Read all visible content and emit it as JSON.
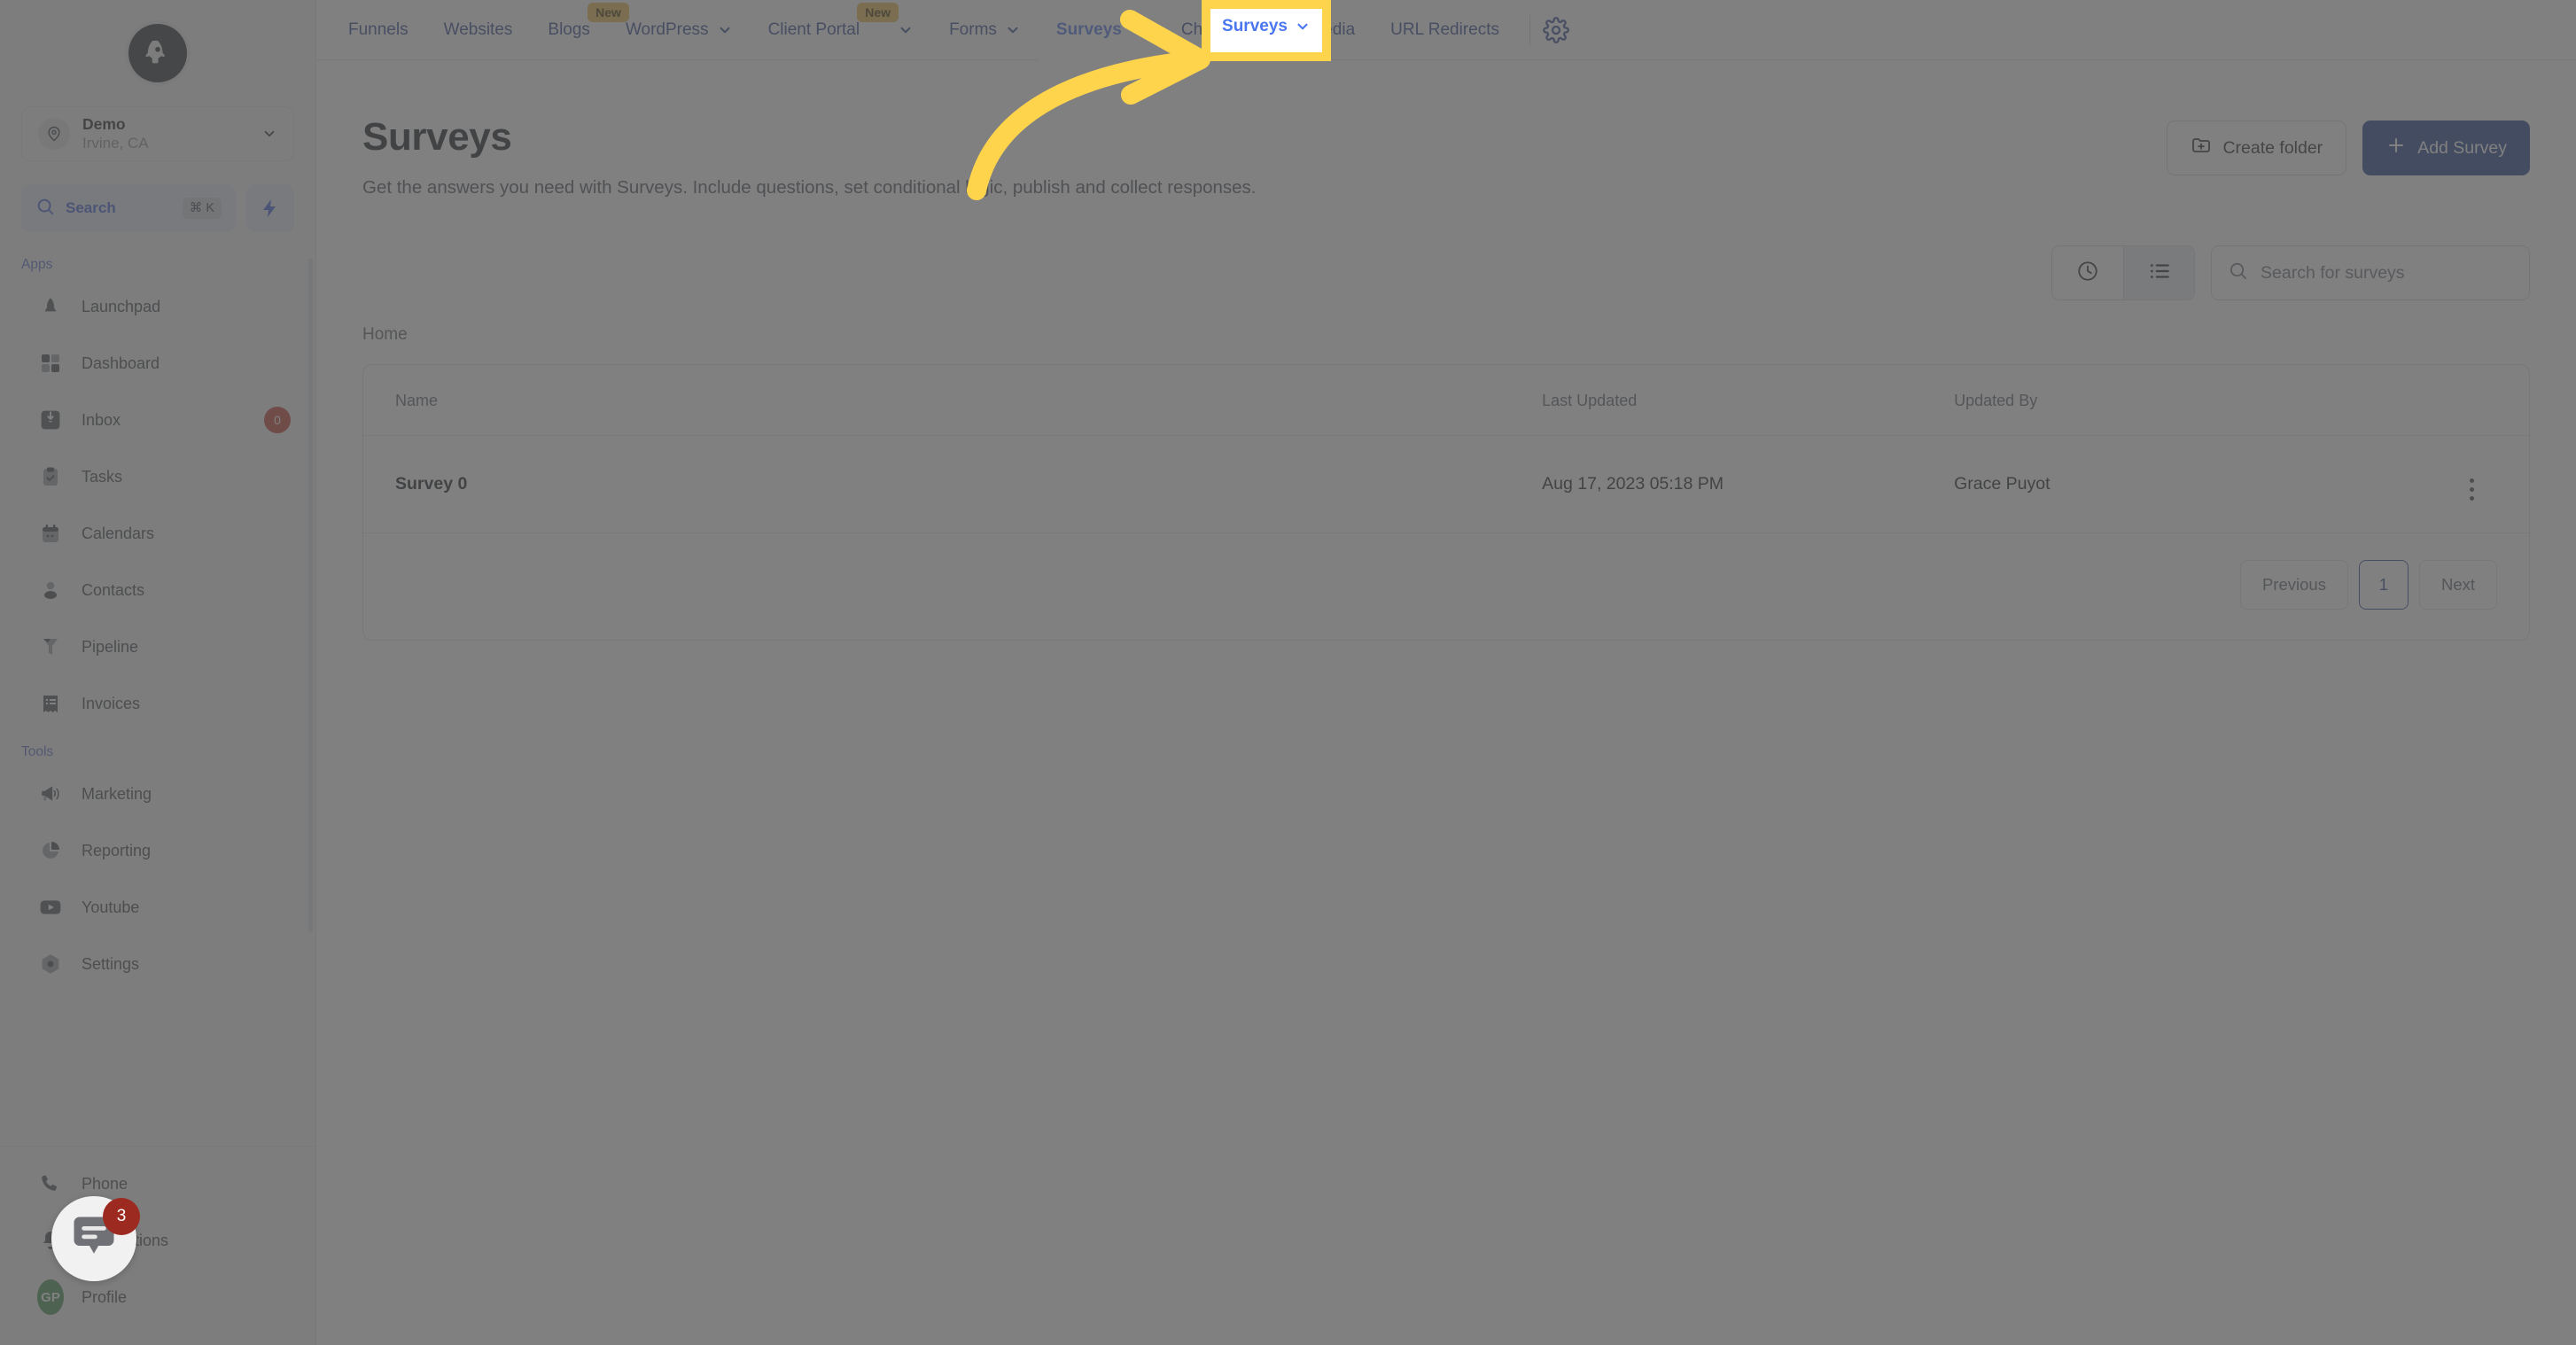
{
  "sidebar": {
    "logo_icon": "rocket-logo-icon",
    "collapse_icon": "collapse-sidebar-icon",
    "location": {
      "name": "Demo",
      "sub": "Irvine, CA",
      "pin_icon": "map-pin-icon",
      "chevron_icon": "chevron-down-icon"
    },
    "search": {
      "label": "Search",
      "shortcut": "⌘ K",
      "icon": "search-icon",
      "bolt_icon": "bolt-icon"
    },
    "sections": [
      {
        "label": "Apps",
        "items": [
          {
            "label": "Launchpad",
            "icon": "launchpad-icon",
            "badge": ""
          },
          {
            "label": "Dashboard",
            "icon": "dashboard-grid-icon",
            "badge": ""
          },
          {
            "label": "Inbox",
            "icon": "inbox-icon",
            "badge": "0"
          },
          {
            "label": "Tasks",
            "icon": "tasks-clipboard-icon",
            "badge": ""
          },
          {
            "label": "Calendars",
            "icon": "calendar-icon",
            "badge": ""
          },
          {
            "label": "Contacts",
            "icon": "contacts-person-icon",
            "badge": ""
          },
          {
            "label": "Pipeline",
            "icon": "pipeline-funnel-icon",
            "badge": ""
          },
          {
            "label": "Invoices",
            "icon": "invoices-icon",
            "badge": ""
          }
        ]
      },
      {
        "label": "Tools",
        "items": [
          {
            "label": "Marketing",
            "icon": "megaphone-icon",
            "badge": ""
          },
          {
            "label": "Reporting",
            "icon": "pie-chart-icon",
            "badge": ""
          },
          {
            "label": "Youtube",
            "icon": "youtube-icon",
            "badge": ""
          },
          {
            "label": "Settings",
            "icon": "settings-gear-icon",
            "badge": ""
          }
        ]
      }
    ],
    "bottom": [
      {
        "label": "Phone",
        "icon": "phone-icon",
        "badge": ""
      },
      {
        "label": "Notifications",
        "icon": "bell-icon",
        "badge": ""
      },
      {
        "label": "Profile",
        "icon": "avatar-icon",
        "badge": "",
        "avatar_initials": "GP"
      }
    ]
  },
  "topnav": {
    "items": [
      {
        "label": "Funnels",
        "badge": "",
        "caret": false,
        "active": false
      },
      {
        "label": "Websites",
        "badge": "",
        "caret": false,
        "active": false
      },
      {
        "label": "Blogs",
        "badge": "New",
        "caret": false,
        "active": false
      },
      {
        "label": "WordPress",
        "badge": "",
        "caret": true,
        "active": false
      },
      {
        "label": "Client Portal",
        "badge": "New",
        "caret": true,
        "active": false
      },
      {
        "label": "Forms",
        "badge": "",
        "caret": true,
        "active": false
      },
      {
        "label": "Surveys",
        "badge": "",
        "caret": true,
        "active": true
      },
      {
        "label": "Chat Widget",
        "badge": "",
        "caret": false,
        "active": false
      },
      {
        "label": "Media",
        "badge": "",
        "caret": false,
        "active": false
      },
      {
        "label": "URL Redirects",
        "badge": "",
        "caret": false,
        "active": false
      }
    ],
    "gear_icon": "gear-icon"
  },
  "page": {
    "title": "Surveys",
    "description": "Get the answers you need with Surveys. Include questions, set conditional logic, publish and collect responses.",
    "create_folder_label": "Create folder",
    "create_folder_icon": "folder-plus-icon",
    "add_survey_label": "Add Survey",
    "add_survey_icon": "plus-icon"
  },
  "toolbar": {
    "recent_icon": "clock-icon",
    "list_icon": "list-view-icon",
    "search_placeholder": "Search for surveys",
    "search_value": "",
    "search_icon": "search-icon"
  },
  "breadcrumb": "Home",
  "table": {
    "columns": [
      "Name",
      "Last Updated",
      "Updated By"
    ],
    "rows": [
      {
        "name": "Survey 0",
        "last_updated": "Aug 17, 2023 05:18 PM",
        "updated_by": "Grace Puyot",
        "actions_icon": "kebab-menu-icon"
      }
    ]
  },
  "pagination": {
    "previous": "Previous",
    "current_page": "1",
    "next": "Next"
  },
  "chat_widget": {
    "icon": "chat-bubble-icon",
    "unread_count": "3"
  },
  "annotation": {
    "arrow_icon": "curved-arrow-icon",
    "highlight_color": "#ffd44d",
    "target": "Surveys"
  },
  "colors": {
    "brand_blue": "#2f4593",
    "active_blue": "#4a76ef",
    "primary_button": "#1d3a8a",
    "highlight_yellow": "#ffd44d",
    "badge_red": "#c0392b",
    "new_badge": "#e9b949"
  }
}
